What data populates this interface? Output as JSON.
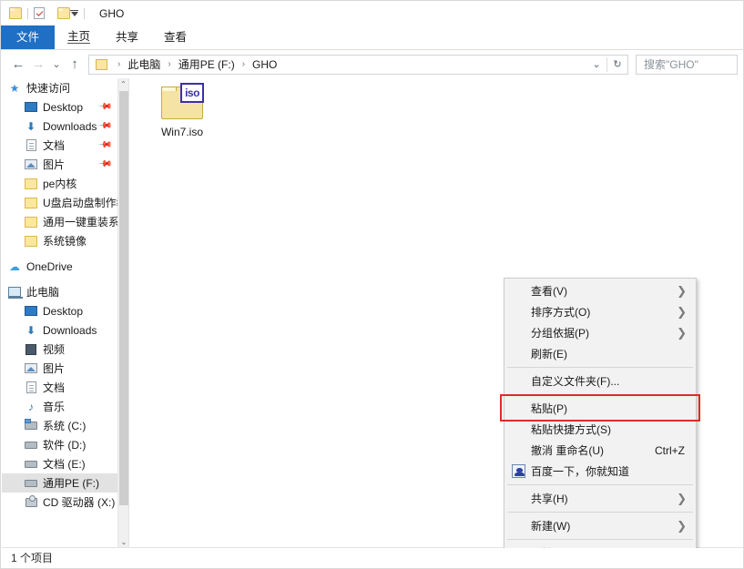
{
  "window": {
    "title": "GHO",
    "quick_access": [
      {
        "name": "folder-icon",
        "label": "文件资源管理器"
      },
      {
        "name": "properties-icon",
        "label": "属性"
      },
      {
        "name": "new-folder-icon",
        "label": "新建文件夹"
      },
      {
        "name": "customize-caret-icon",
        "label": "自定义快速访问工具栏"
      }
    ]
  },
  "ribbon": {
    "tabs": [
      {
        "label": "文件",
        "active": true
      },
      {
        "label": "主页",
        "active": false
      },
      {
        "label": "共享",
        "active": false
      },
      {
        "label": "查看",
        "active": false
      }
    ]
  },
  "navigation": {
    "back_icon": "←",
    "forward_icon": "→",
    "recent_icon": "⌄",
    "up_icon": "↑",
    "breadcrumb": [
      "此电脑",
      "通用PE (F:)",
      "GHO"
    ],
    "breadcrumb_separator": "›",
    "dropdown_icon": "⌄",
    "refresh_icon": "↻",
    "search_placeholder": "搜索\"GHO\""
  },
  "sidebar": {
    "items": [
      {
        "label": "快速访问",
        "icon": "star-icon",
        "indent": 0,
        "pinned": false,
        "selected": false
      },
      {
        "label": "Desktop",
        "icon": "desktop-icon",
        "indent": 1,
        "pinned": true,
        "selected": false
      },
      {
        "label": "Downloads",
        "icon": "downloads-icon",
        "indent": 1,
        "pinned": true,
        "selected": false
      },
      {
        "label": "文档",
        "icon": "documents-icon",
        "indent": 1,
        "pinned": true,
        "selected": false
      },
      {
        "label": "图片",
        "icon": "pictures-icon",
        "indent": 1,
        "pinned": true,
        "selected": false
      },
      {
        "label": "pe内核",
        "icon": "folder-icon",
        "indent": 1,
        "pinned": false,
        "selected": false
      },
      {
        "label": "U盘启动盘制作教程",
        "icon": "folder-icon",
        "indent": 1,
        "pinned": false,
        "selected": false
      },
      {
        "label": "通用一键重装系统",
        "icon": "folder-icon",
        "indent": 1,
        "pinned": false,
        "selected": false
      },
      {
        "label": "系统镜像",
        "icon": "folder-icon",
        "indent": 1,
        "pinned": false,
        "selected": false
      },
      {
        "label": "OneDrive",
        "icon": "cloud-icon",
        "indent": 0,
        "pinned": false,
        "selected": false
      },
      {
        "label": "此电脑",
        "icon": "this-pc-icon",
        "indent": 0,
        "pinned": false,
        "selected": false
      },
      {
        "label": "Desktop",
        "icon": "desktop-icon",
        "indent": 1,
        "pinned": false,
        "selected": false
      },
      {
        "label": "Downloads",
        "icon": "downloads-icon",
        "indent": 1,
        "pinned": false,
        "selected": false
      },
      {
        "label": "视频",
        "icon": "videos-icon",
        "indent": 1,
        "pinned": false,
        "selected": false
      },
      {
        "label": "图片",
        "icon": "pictures-icon",
        "indent": 1,
        "pinned": false,
        "selected": false
      },
      {
        "label": "文档",
        "icon": "documents-icon",
        "indent": 1,
        "pinned": false,
        "selected": false
      },
      {
        "label": "音乐",
        "icon": "music-icon",
        "indent": 1,
        "pinned": false,
        "selected": false
      },
      {
        "label": "系统 (C:)",
        "icon": "system-drive-icon",
        "indent": 1,
        "pinned": false,
        "selected": false
      },
      {
        "label": "软件 (D:)",
        "icon": "drive-icon",
        "indent": 1,
        "pinned": false,
        "selected": false
      },
      {
        "label": "文档 (E:)",
        "icon": "drive-icon",
        "indent": 1,
        "pinned": false,
        "selected": false
      },
      {
        "label": "通用PE (F:)",
        "icon": "drive-icon",
        "indent": 1,
        "pinned": false,
        "selected": true
      },
      {
        "label": "CD 驱动器 (X:)",
        "icon": "cd-drive-icon",
        "indent": 1,
        "pinned": false,
        "selected": false
      }
    ],
    "scroll_up_icon": "⌃",
    "scroll_down_icon": "⌄"
  },
  "files": [
    {
      "name": "Win7.iso",
      "icon": "iso-file-icon",
      "badge": "iso"
    }
  ],
  "context_menu": {
    "highlighted_item": "粘贴(P)",
    "highlight_color": "#e02b27",
    "items": [
      {
        "label": "查看(V)",
        "submenu": true,
        "accel": "",
        "icon": "",
        "sep_after": false
      },
      {
        "label": "排序方式(O)",
        "submenu": true,
        "accel": "",
        "icon": "",
        "sep_after": false
      },
      {
        "label": "分组依据(P)",
        "submenu": true,
        "accel": "",
        "icon": "",
        "sep_after": false
      },
      {
        "label": "刷新(E)",
        "submenu": false,
        "accel": "",
        "icon": "",
        "sep_after": true
      },
      {
        "label": "自定义文件夹(F)...",
        "submenu": false,
        "accel": "",
        "icon": "",
        "sep_after": true
      },
      {
        "label": "粘贴(P)",
        "submenu": false,
        "accel": "",
        "icon": "",
        "sep_after": false,
        "highlighted": true
      },
      {
        "label": "粘贴快捷方式(S)",
        "submenu": false,
        "accel": "",
        "icon": "",
        "sep_after": false
      },
      {
        "label": "撤消 重命名(U)",
        "submenu": false,
        "accel": "Ctrl+Z",
        "icon": "",
        "sep_after": false
      },
      {
        "label": "百度一下，你就知道",
        "submenu": false,
        "accel": "",
        "icon": "baidu-icon",
        "sep_after": true
      },
      {
        "label": "共享(H)",
        "submenu": true,
        "accel": "",
        "icon": "",
        "sep_after": true
      },
      {
        "label": "新建(W)",
        "submenu": true,
        "accel": "",
        "icon": "",
        "sep_after": true
      },
      {
        "label": "属性(R)",
        "submenu": false,
        "accel": "",
        "icon": "",
        "sep_after": false
      }
    ],
    "submenu_arrow": "❯"
  },
  "statusbar": {
    "item_count_text": "1 个项目"
  }
}
